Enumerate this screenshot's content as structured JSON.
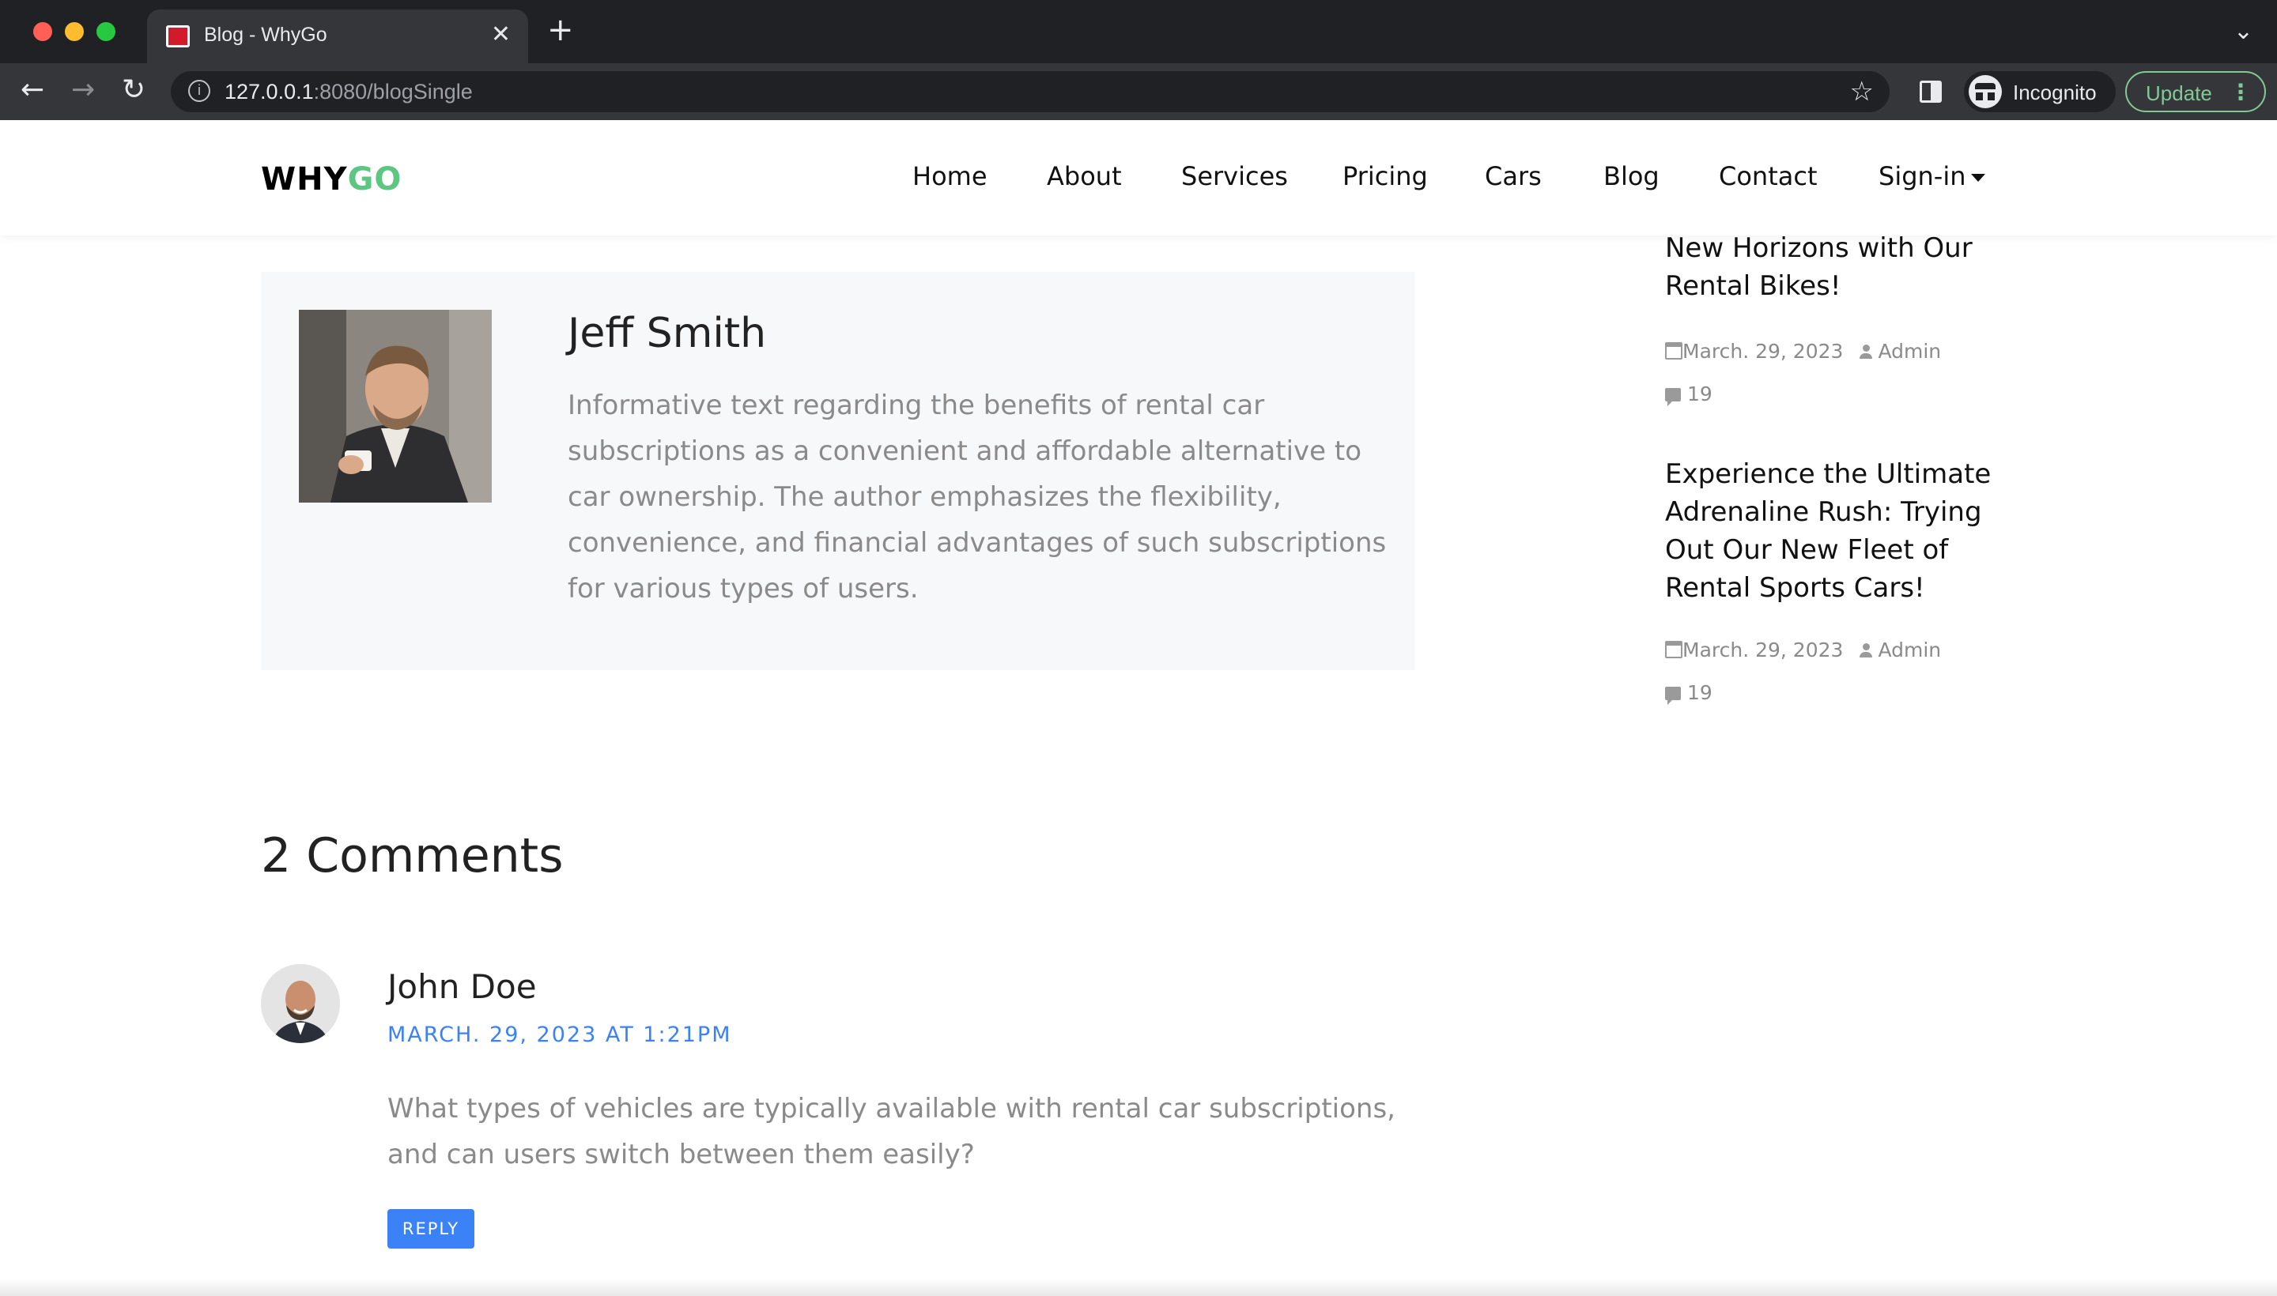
{
  "browser": {
    "tab_title": "Blog - WhyGo",
    "url_host": "127.0.0.1",
    "url_rest": ":8080/blogSingle",
    "profile_label": "Incognito",
    "update_label": "Update"
  },
  "site": {
    "logo_part1": "WHY",
    "logo_part2": "GO",
    "logo_accent_color": "#5dc682",
    "nav": {
      "home": "Home",
      "about": "About",
      "services": "Services",
      "pricing": "Pricing",
      "cars": "Cars",
      "blog": "Blog",
      "contact": "Contact",
      "signin": "Sign-in"
    }
  },
  "author": {
    "name": "Jeff Smith",
    "bio": "Informative text regarding the benefits of rental car subscriptions as a convenient and affordable alternative to car ownership. The author emphasizes the flexibility, convenience, and financial advantages of such subscriptions for various types of users."
  },
  "comments": {
    "title": "2 Comments",
    "items": [
      {
        "name": "John Doe",
        "date": "MARCH. 29, 2023 AT 1:21PM",
        "text": "What types of vehicles are typically available with rental car subscriptions, and can users switch between them easily?",
        "reply_label": "REPLY"
      }
    ]
  },
  "sidebar": {
    "posts": [
      {
        "title_line1": "New Horizons with Our",
        "title_line2": "Rental Bikes!",
        "date": "March. 29, 2023",
        "author": "Admin",
        "comments": "19"
      },
      {
        "title": "Experience the Ultimate Adrenaline Rush: Trying Out Our New Fleet of Rental Sports Cars!",
        "date": "March. 29, 2023",
        "author": "Admin",
        "comments": "19"
      }
    ]
  },
  "colors": {
    "accent_blue": "#3b82f6",
    "chrome_dark": "#202124"
  }
}
